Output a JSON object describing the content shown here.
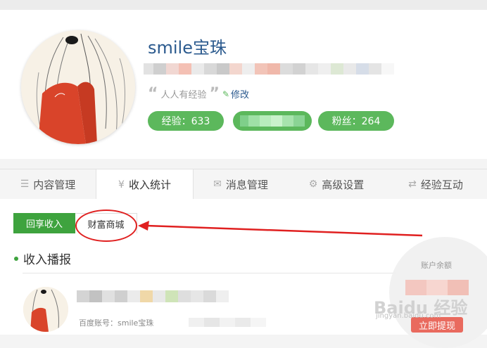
{
  "profile": {
    "username": "smile宝珠",
    "motto": "人人有经验",
    "edit_label": "修改",
    "experience_label": "经验：633",
    "fans_label": "粉丝：264"
  },
  "tabs": [
    {
      "label": "内容管理",
      "icon": "list-icon"
    },
    {
      "label": "收入统计",
      "icon": "yen-icon"
    },
    {
      "label": "消息管理",
      "icon": "mail-icon"
    },
    {
      "label": "高级设置",
      "icon": "gear-icon"
    },
    {
      "label": "经验互动",
      "icon": "swap-icon"
    }
  ],
  "subtabs": {
    "active": "回享收入",
    "second": "财富商城"
  },
  "section": {
    "title": "收入播报",
    "account_label": "百度账号：smile宝珠"
  },
  "balance": {
    "label": "账户余额",
    "withdraw_label": "立即提现"
  },
  "watermark": {
    "text": "Baidu 经验",
    "sub": "jingyan.baidu.com"
  },
  "colors": {
    "accent_green": "#5cb85c",
    "link_blue": "#2b5a8e",
    "annotation_red": "#e02020"
  }
}
